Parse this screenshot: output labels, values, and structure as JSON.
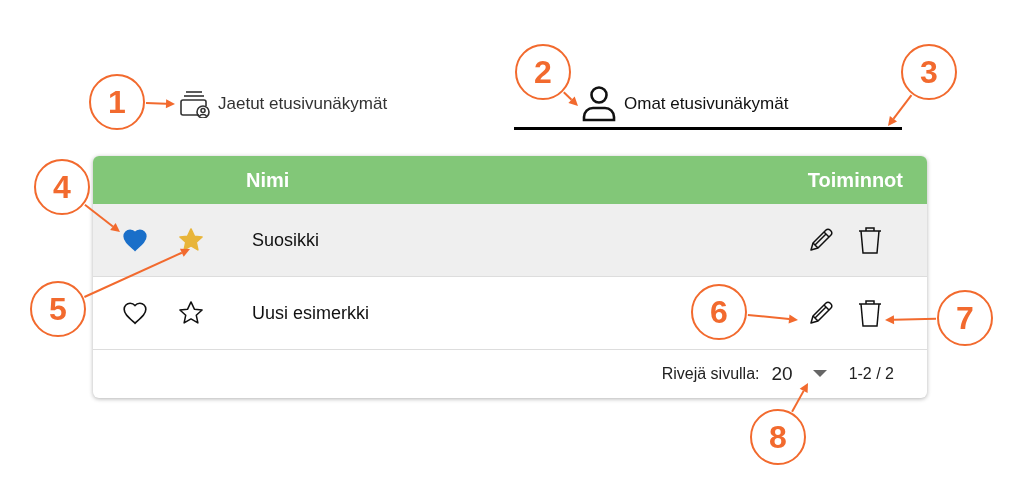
{
  "tabs": [
    {
      "label": "Jaetut etusivunäkymät",
      "kind": "shared",
      "selected": false
    },
    {
      "label": "Omat etusivunäkymät",
      "kind": "own",
      "selected": true
    }
  ],
  "table": {
    "columns": [
      "Nimi",
      "Toiminnot"
    ],
    "rows": [
      {
        "name": "Suosikki",
        "favorite": true,
        "starred": true,
        "highlighted": true
      },
      {
        "name": "Uusi esimerkki",
        "favorite": false,
        "starred": false,
        "highlighted": false
      }
    ],
    "footer": {
      "rows_per_page_label": "Rivejä sivulla:",
      "rows_per_page": "20",
      "range": "1-2 / 2"
    }
  },
  "callouts": [
    "1",
    "2",
    "3",
    "4",
    "5",
    "6",
    "7",
    "8"
  ]
}
